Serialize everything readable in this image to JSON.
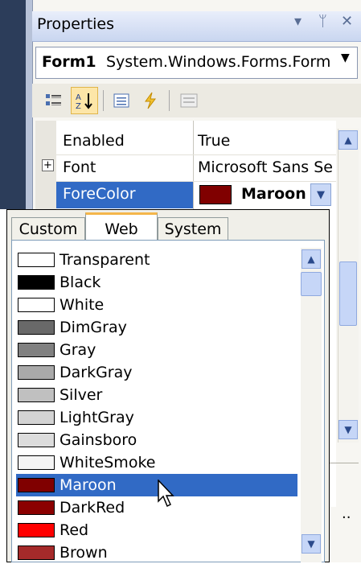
{
  "panel": {
    "title": "Properties",
    "title_icons": [
      "dropdown-arrow-icon",
      "pin-icon",
      "close-icon"
    ],
    "object_name": "Form1",
    "object_type": "System.Windows.Forms.Form"
  },
  "toolbar": {
    "buttons": [
      "categorized-icon",
      "alphabetical-icon",
      "properties-icon",
      "events-icon",
      "property-pages-icon"
    ]
  },
  "grid": {
    "rows": [
      {
        "name": "Enabled",
        "value": "True"
      },
      {
        "name": "Font",
        "value": "Microsoft Sans Se"
      },
      {
        "name": "ForeColor",
        "value": "Maroon"
      }
    ],
    "expand_glyph": "+",
    "more_glyph": ".."
  },
  "picker": {
    "tabs": [
      "Custom",
      "Web",
      "System"
    ],
    "active_tab": "Web",
    "items": [
      {
        "label": "Transparent",
        "color": "#ffffff"
      },
      {
        "label": "Black",
        "color": "#000000"
      },
      {
        "label": "White",
        "color": "#ffffff"
      },
      {
        "label": "DimGray",
        "color": "#696969"
      },
      {
        "label": "Gray",
        "color": "#808080"
      },
      {
        "label": "DarkGray",
        "color": "#a9a9a9"
      },
      {
        "label": "Silver",
        "color": "#c0c0c0"
      },
      {
        "label": "LightGray",
        "color": "#d3d3d3"
      },
      {
        "label": "Gainsboro",
        "color": "#dcdcdc"
      },
      {
        "label": "WhiteSmoke",
        "color": "#f5f5f5"
      },
      {
        "label": "Maroon",
        "color": "#800000"
      },
      {
        "label": "DarkRed",
        "color": "#8b0000"
      },
      {
        "label": "Red",
        "color": "#ff0000"
      },
      {
        "label": "Brown",
        "color": "#a52a2a"
      }
    ],
    "selected": "Maroon"
  },
  "colors": {
    "selection": "#316ac5",
    "maroon": "#800000"
  }
}
